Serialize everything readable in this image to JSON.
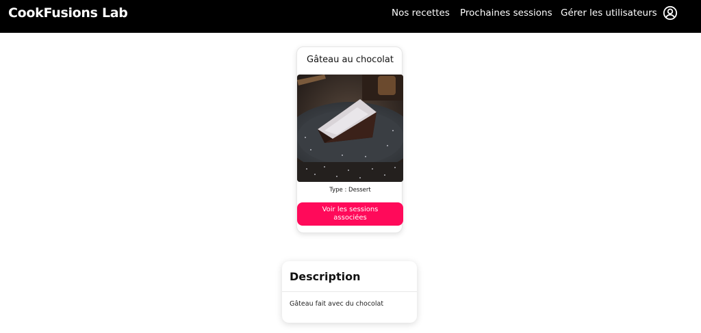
{
  "navbar": {
    "brand": "CookFusions Lab",
    "links": [
      "Nos recettes",
      "Prochaines sessions",
      "Gérer les utilisateurs"
    ],
    "user_icon": "user-circle-icon"
  },
  "recipe": {
    "title": "Gâteau au chocolat",
    "type_label": "Type : Dessert",
    "button_label": "Voir les sessions associées",
    "image": "chocolate-cake-slice-photo"
  },
  "description": {
    "heading": "Description",
    "text": "Gâteau fait avec du chocolat"
  },
  "colors": {
    "navbar_bg": "#000000",
    "accent": "#ff0a5a"
  }
}
